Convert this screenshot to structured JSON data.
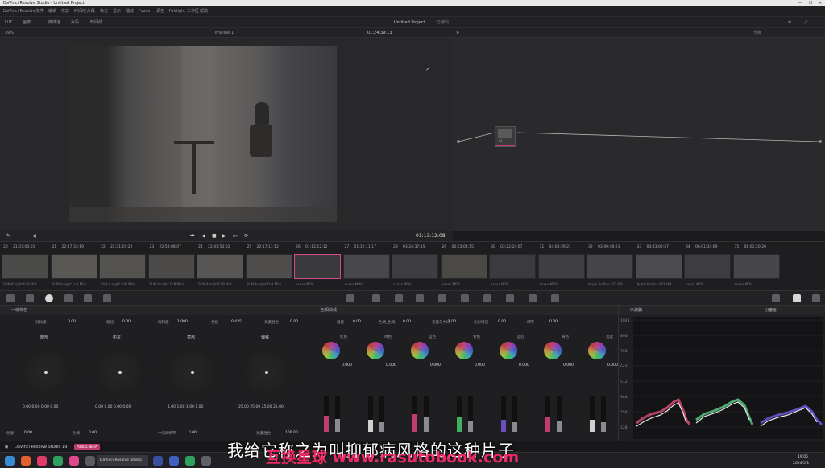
{
  "titlebar": {
    "title": "DaVinci Resolve Studio - Untitled Project"
  },
  "menubar": {
    "items": [
      "DaVinci Resolve",
      "文件",
      "编辑",
      "修剪",
      "时间线",
      "片段",
      "标记",
      "显示",
      "播放",
      "Fusion",
      "调色",
      "Fairlight",
      "工作区",
      "帮助"
    ]
  },
  "toolbar": {
    "left_items": [
      "LUT",
      "画廊",
      "媒体池",
      "片段",
      "时间线"
    ],
    "project_title": "Untitled Project",
    "edit_status": "已编辑"
  },
  "viewer": {
    "zoom": "39%",
    "timeline_name": "Timeline 1",
    "timecode_top": "01:24:39:13",
    "timecode": "01:13:12:08",
    "nodes_label": "节点"
  },
  "clips": {
    "numbers": [
      "20",
      "21",
      "22",
      "23",
      "24",
      "25",
      "26",
      "27",
      "28",
      "29",
      "30",
      "31",
      "32",
      "33",
      "34",
      "35"
    ],
    "timecodes": [
      "21:07:03:01",
      "22:47:33:19",
      "22:31:19:22",
      "22:54:08:07",
      "22:41:53:02",
      "22:17:11:12",
      "01:12:12:12",
      "01:12:11:17",
      "03:24:37:15",
      "00:55:04:15",
      "03:22:24:07",
      "04:04:39:21",
      "03:49:46:21",
      "03:43:02:57",
      "06:01:34:09",
      "06:01:20:20"
    ],
    "labels": [
      "SUN·A:night FnB Mini...",
      "SUN·A:night FnB Mini...",
      "SUN·A:night FnB Mini...",
      "SUN·A:night FnB Mini...",
      "SUN·A:night FnB Mini...",
      "SUN·A:night FnB Mini...",
      "xxxxx.MOV",
      "xxxxx.MOV",
      "xxxxx.MOV",
      "xxxxx.MOV",
      "xxxxx.MOV",
      "xxxxx.MOV",
      "Apple ProRes 422 HQ",
      "Apple ProRes 422 HQ",
      "xxxxx.MOV",
      "xxxxx.MOV"
    ]
  },
  "wheels": {
    "header": "一级校色",
    "top_controls": [
      {
        "label": "对比度",
        "value": "0.00"
      },
      {
        "label": "枢纽",
        "value": "0.00"
      },
      {
        "label": "饱和度",
        "value": "1.000"
      },
      {
        "label": "色相",
        "value": "0.435"
      },
      {
        "label": "亮度混合",
        "value": "0.00"
      }
    ],
    "wheels": [
      {
        "name": "暗部",
        "values": "0.00 0.00 0.00 0.00"
      },
      {
        "name": "中灰",
        "values": "0.00 0.00 0.00 0.00"
      },
      {
        "name": "亮部",
        "values": "1.00 1.00 1.00 1.00"
      },
      {
        "name": "偏移",
        "values": "25.00 25.00 25.00 25.00"
      }
    ],
    "bottom_controls": [
      {
        "label": "色温",
        "value": "0.00"
      },
      {
        "label": "色调",
        "value": "0.00"
      },
      {
        "label": "中间调细节",
        "value": "0.00"
      },
      {
        "label": "亮度混合",
        "value": "100.00"
      }
    ]
  },
  "mixer": {
    "header": "色相曲线",
    "top_controls": [
      {
        "label": "温度",
        "value": "0.00"
      },
      {
        "label": "色调_色调",
        "value": "0.00"
      },
      {
        "label": "亮度与中间",
        "value": "1.00"
      },
      {
        "label": "色彩增强",
        "value": "0.00"
      },
      {
        "label": "细节",
        "value": "0.00"
      }
    ],
    "channels": [
      {
        "name": "红色",
        "value": "0.000",
        "fill": 0.45,
        "color": "#c03c6c"
      },
      {
        "name": "绿色",
        "value": "0.000",
        "fill": 0.35,
        "color": "#d0d0d0"
      },
      {
        "name": "蓝色",
        "value": "0.000",
        "fill": 0.5,
        "color": "#c03c6c"
      },
      {
        "name": "青色",
        "value": "0.000",
        "fill": 0.4,
        "color": "#40b060"
      },
      {
        "name": "品红",
        "value": "0.000",
        "fill": 0.35,
        "color": "#6a4fc0"
      },
      {
        "name": "黄色",
        "value": "0.000",
        "fill": 0.4,
        "color": "#c03c6c"
      },
      {
        "name": "亮度",
        "value": "0.000",
        "fill": 0.35,
        "color": "#d0d0d0"
      }
    ]
  },
  "scope": {
    "header": "示波器",
    "mode": "分量图",
    "ticks": [
      "1023",
      "896",
      "768",
      "640",
      "512",
      "384",
      "256",
      "128"
    ]
  },
  "statusbar": {
    "app": "DaVinci Resolve Studio 19",
    "badge": "PUBLIC BETA"
  },
  "taskbar": {
    "running_app": "DaVinci Resolve Studio",
    "clock": "19:05",
    "date": "2024/5/1"
  },
  "overlay": {
    "subtitle": "我给它称之为叫抑郁病风格的这种片子",
    "watermark": "互换星球 www.rasutobook.com"
  },
  "colors": {
    "accent": "#c03c6c",
    "selected_clip": "#d64a8a"
  }
}
